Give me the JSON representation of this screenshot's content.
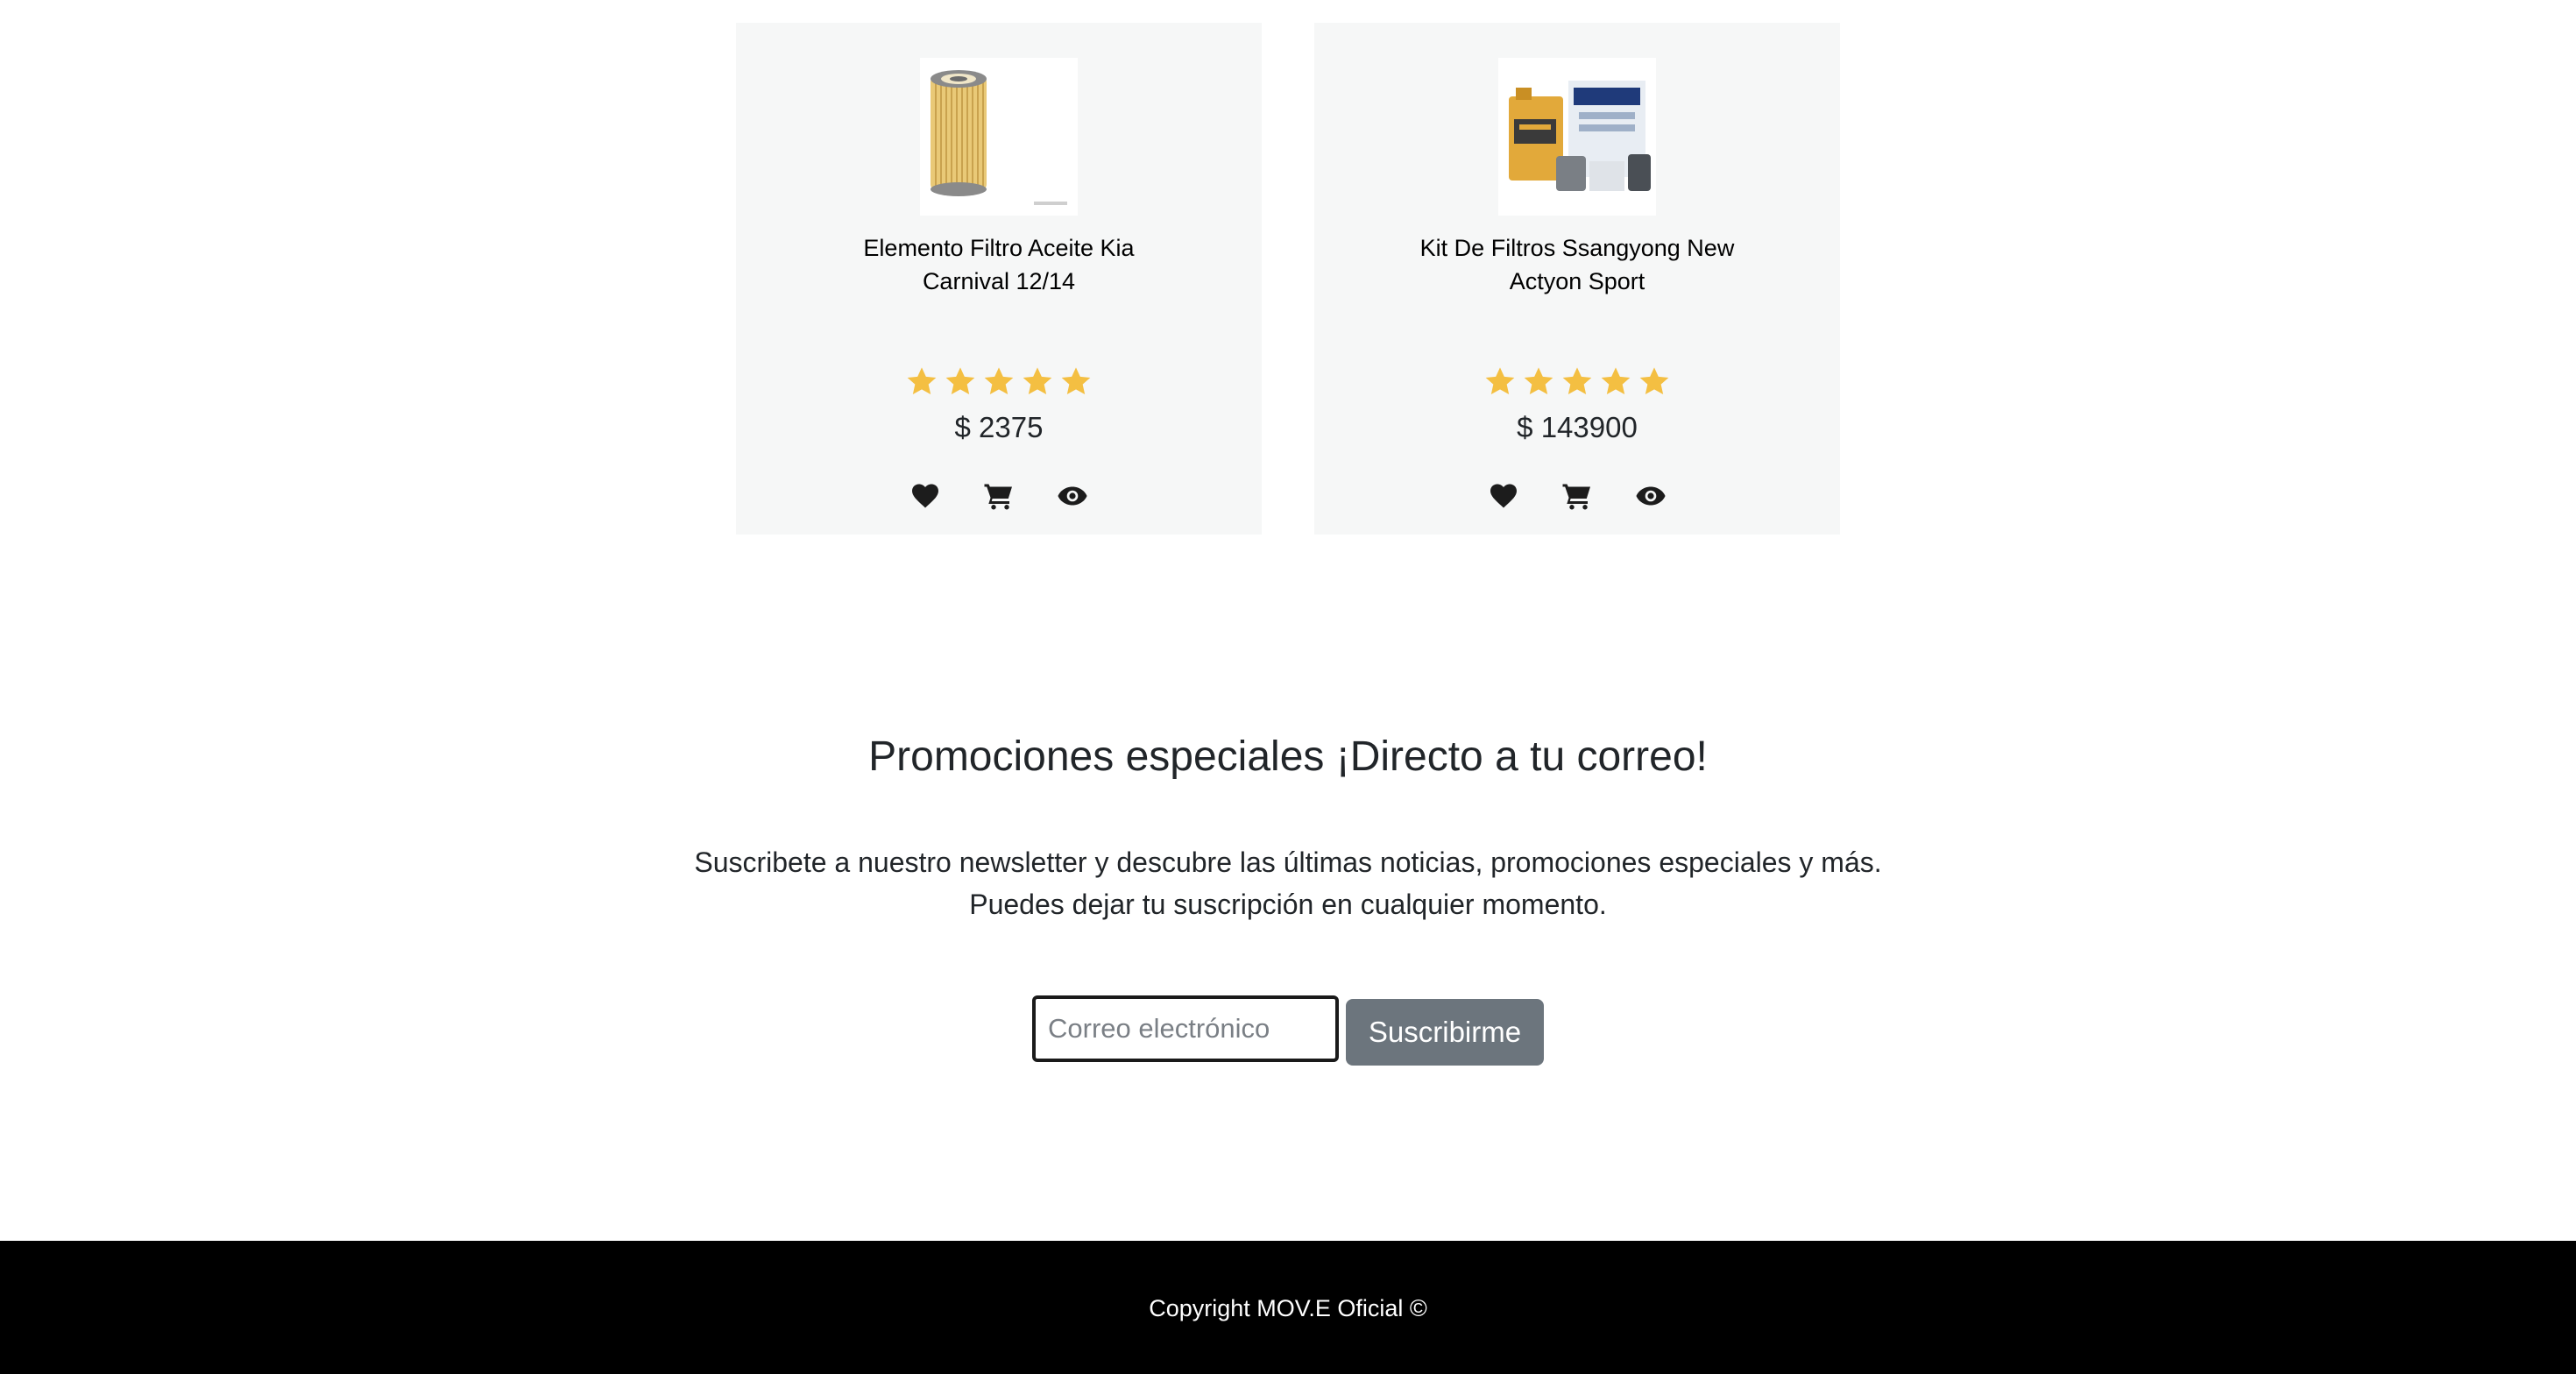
{
  "products": [
    {
      "name_line1": "Elemento Filtro Aceite Kia",
      "name_line2": "Carnival 12/14",
      "rating": 5,
      "price": "$ 2375",
      "image_icon": "oil-filter-image"
    },
    {
      "name_line1": "Kit De Filtros Ssangyong New",
      "name_line2": "Actyon Sport",
      "rating": 5,
      "price": "$ 143900",
      "image_icon": "filter-kit-image"
    }
  ],
  "action_icons": [
    "heart-icon",
    "cart-icon",
    "eye-icon"
  ],
  "newsletter": {
    "title": "Promociones especiales ¡Directo a tu correo!",
    "text_line1": "Suscribete a nuestro newsletter y descubre las últimas noticias, promociones especiales y más.",
    "text_line2": "Puedes dejar tu suscripción en cualquier momento.",
    "email_placeholder": "Correo electrónico",
    "email_value": "",
    "button_label": "Suscribirme"
  },
  "footer": {
    "copyright": "Copyright MOV.E Oficial ©"
  },
  "colors": {
    "card_background": "#f6f7f7",
    "star": "#f4bf42",
    "button": "#6c757d",
    "footer": "#000000",
    "text": "#212529"
  }
}
